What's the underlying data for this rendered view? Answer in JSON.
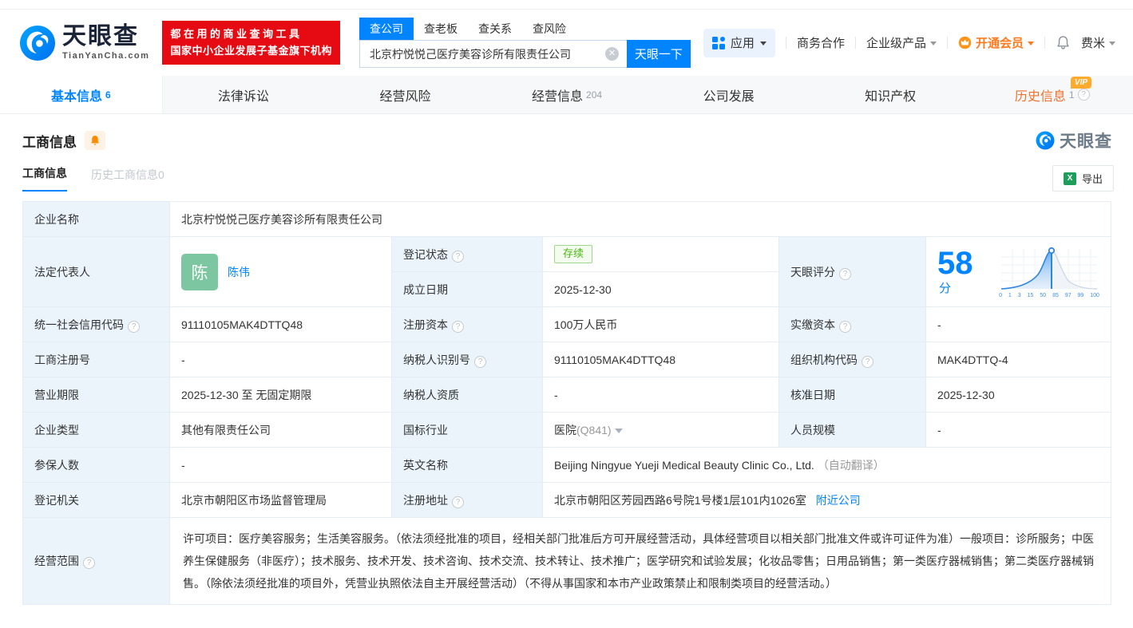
{
  "colors": {
    "brand_blue": "#0084ff",
    "promo_red": "#e60b13",
    "vip_orange": "#ff7a1e",
    "status_green": "#49b812",
    "score_blue": "#2f86e0"
  },
  "header": {
    "brand": "天眼查",
    "brand_domain": "TianYanCha.com",
    "promo_line1": "都在用的商业查询工具",
    "promo_line2": "国家中小企业发展子基金旗下机构",
    "search": {
      "tabs": [
        {
          "label": "查公司"
        },
        {
          "label": "查老板"
        },
        {
          "label": "查关系"
        },
        {
          "label": "查风险"
        }
      ],
      "value": "北京柠悦悦己医疗美容诊所有限责任公司",
      "button_label": "天眼一下"
    },
    "menu": {
      "apps_label": "应用",
      "biz_coop_label": "商务合作",
      "enterprise_label": "企业级产品",
      "vip_label": "开通会员",
      "username": "费米"
    }
  },
  "nav_tabs": [
    {
      "label": "基本信息",
      "count": "6"
    },
    {
      "label": "法律诉讼"
    },
    {
      "label": "经营风险"
    },
    {
      "label": "经营信息",
      "count": "204"
    },
    {
      "label": "公司发展"
    },
    {
      "label": "知识产权"
    },
    {
      "label": "历史信息",
      "count": "1",
      "vip_badge": "VIP"
    }
  ],
  "section": {
    "title": "工商信息",
    "watermark_brand": "天眼查",
    "subtab_active": "工商信息",
    "subtab_history": "历史工商信息0",
    "export_label": "导出"
  },
  "table": {
    "company_name_label": "企业名称",
    "company_name": "北京柠悦悦己医疗美容诊所有限责任公司",
    "legal_rep_label": "法定代表人",
    "legal_rep_initial": "陈",
    "legal_rep_name": "陈伟",
    "reg_status_label": "登记状态",
    "reg_status": "存续",
    "establish_date_label": "成立日期",
    "establish_date": "2025-12-30",
    "score_label": "天眼评分",
    "uscc_label": "统一社会信用代码",
    "uscc": "91110105MAK4DTTQ48",
    "reg_capital_label": "注册资本",
    "reg_capital": "100万人民币",
    "paid_capital_label": "实缴资本",
    "paid_capital": "-",
    "reg_no_label": "工商注册号",
    "reg_no": "-",
    "taxpayer_id_label": "纳税人识别号",
    "taxpayer_id": "91110105MAK4DTTQ48",
    "org_code_label": "组织机构代码",
    "org_code": "MAK4DTTQ-4",
    "term_label": "营业期限",
    "term": "2025-12-30 至 无固定期限",
    "taxpayer_quality_label": "纳税人资质",
    "taxpayer_quality": "-",
    "approval_date_label": "核准日期",
    "approval_date": "2025-12-30",
    "company_type_label": "企业类型",
    "company_type": "其他有限责任公司",
    "industry_label": "国标行业",
    "industry": "医院",
    "industry_code": "(Q841)",
    "staff_label": "人员规模",
    "staff": "-",
    "insured_label": "参保人数",
    "insured": "-",
    "english_name_label": "英文名称",
    "english_name": "Beijing Ningyue Yueji Medical Beauty Clinic Co., Ltd.",
    "english_name_note": "（自动翻译）",
    "authority_label": "登记机关",
    "authority": "北京市朝阳区市场监督管理局",
    "address_label": "注册地址",
    "address": "北京市朝阳区芳园西路6号院1号楼1层101内1026室",
    "nearby_label": "附近公司",
    "scope_label": "经营范围",
    "scope": "许可项目：医疗美容服务；生活美容服务。（依法须经批准的项目，经相关部门批准后方可开展经营活动，具体经营项目以相关部门批准文件或许可证件为准）一般项目：诊所服务；中医养生保健服务（非医疗）；技术服务、技术开发、技术咨询、技术交流、技术转让、技术推广；医学研究和试验发展；化妆品零售；日用品销售；第一类医疗器械销售；第二类医疗器械销售。（除依法须经批准的项目外，凭营业执照依法自主开展经营活动）（不得从事国家和本市产业政策禁止和限制类项目的经营活动。）"
  },
  "score_chart": {
    "type": "line",
    "score": "58",
    "unit": "分",
    "axis_ticks": [
      "0",
      "1",
      "3",
      "15",
      "50",
      "85",
      "97",
      "99",
      "100"
    ],
    "marker_percent": 53
  }
}
